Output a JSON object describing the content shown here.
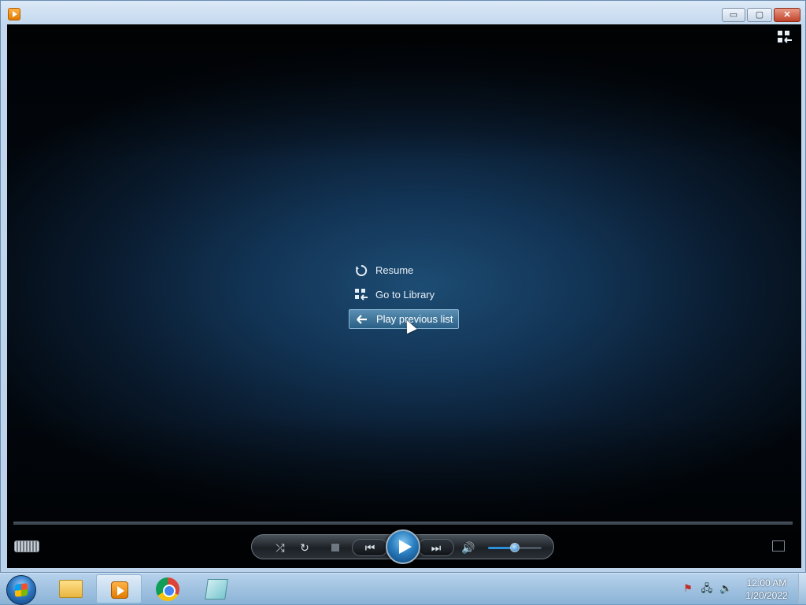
{
  "window": {
    "title": "",
    "buttons": {
      "minimize": "▭",
      "maximize": "▢",
      "close": "✕"
    }
  },
  "player": {
    "menu": [
      {
        "label": "Resume",
        "icon": "resume-icon"
      },
      {
        "label": "Go to Library",
        "icon": "library-icon"
      },
      {
        "label": "Play previous list",
        "icon": "back-arrow-icon",
        "selected": true
      }
    ],
    "controls": {
      "shuffle": "⤮",
      "repeat": "↻",
      "prev": "⏮",
      "next": "⏭",
      "mute": "🔊",
      "volume_fraction": 0.5
    }
  },
  "taskbar": {
    "apps": [
      "Windows Explorer",
      "Windows Media Player",
      "Google Chrome",
      "Notes"
    ],
    "tray_icons": [
      "action-center-flag-icon",
      "network-icon",
      "volume-icon"
    ],
    "tray_glyphs": {
      "flag": "⚑",
      "network": "🖧",
      "volume": "🔉"
    },
    "time": "12:00 AM",
    "date": "1/20/2022"
  },
  "colors": {
    "accent": "#2a7ec0",
    "menu_selected": "#3a6f96"
  }
}
